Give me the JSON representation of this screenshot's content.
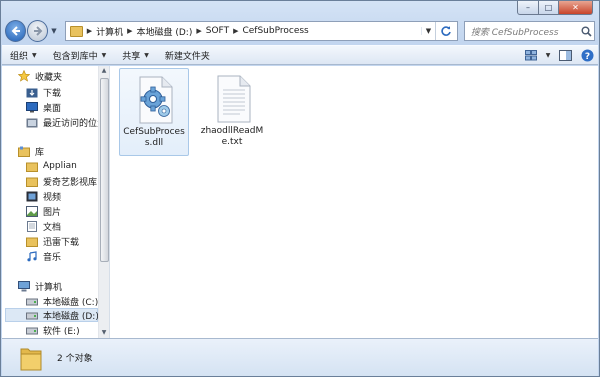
{
  "caption": {
    "minimize": "–",
    "maximize": "□",
    "close": "✕"
  },
  "address": {
    "crumbs": [
      "计算机",
      "本地磁盘 (D:)",
      "SOFT",
      "CefSubProcess"
    ],
    "search_placeholder": "搜索 CefSubProcess"
  },
  "toolbar": {
    "organize": "组织",
    "include_in_library": "包含到库中",
    "share": "共享",
    "new_folder": "新建文件夹"
  },
  "nav": {
    "favorites": "收藏夹",
    "downloads": "下载",
    "desktop": "桌面",
    "recent": "最近访问的位置",
    "libraries": "库",
    "applian": "Applian",
    "iqiyi": "爱奇艺影视库",
    "videos": "视频",
    "pictures": "图片",
    "documents": "文档",
    "thunder": "迅雷下载",
    "music": "音乐",
    "computer": "计算机",
    "drive_c": "本地磁盘 (C:)",
    "drive_d": "本地磁盘 (D:)",
    "drive_e": "软件 (E:)"
  },
  "files": [
    {
      "name": "CefSubProcess.dll",
      "icon": "dll-gear-icon"
    },
    {
      "name": "zhaodllReadMe.txt",
      "icon": "text-file-icon"
    }
  ],
  "status": {
    "item_count": "2 个对象"
  },
  "colors": {
    "selection": "#dce8f5",
    "chrome": "#c3d6ef",
    "accent": "#2d6bbf"
  }
}
